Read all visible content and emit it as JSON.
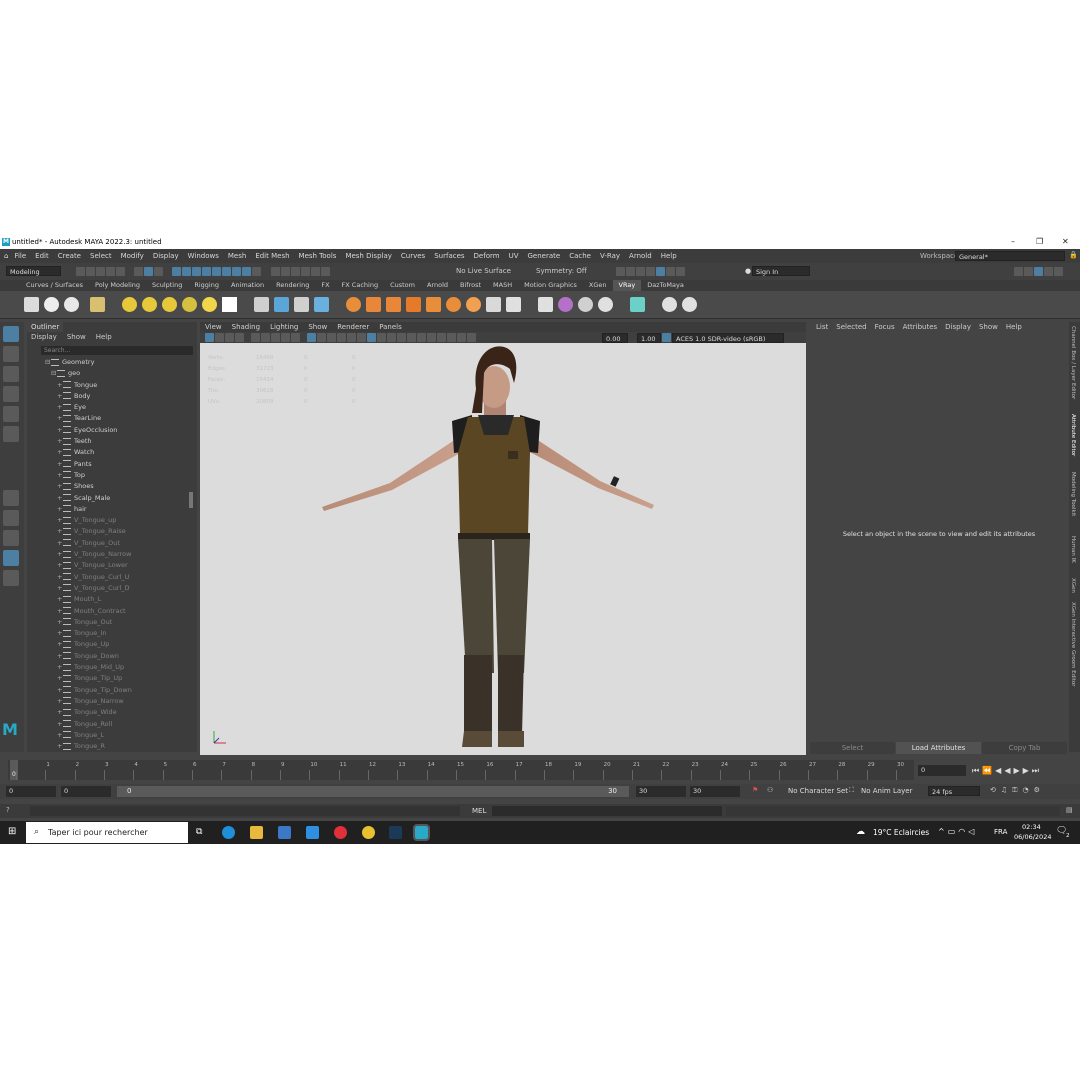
{
  "window": {
    "title": "untitled* - Autodesk MAYA 2022.3: untitled",
    "app_letter": "M"
  },
  "menu": [
    "File",
    "Edit",
    "Create",
    "Select",
    "Modify",
    "Display",
    "Windows",
    "Mesh",
    "Edit Mesh",
    "Mesh Tools",
    "Mesh Display",
    "Curves",
    "Surfaces",
    "Deform",
    "UV",
    "Generate",
    "Cache",
    "V-Ray",
    "Arnold",
    "Help"
  ],
  "workspace": {
    "label": "Workspace:",
    "value": "General*"
  },
  "toolbar": {
    "mode": "Modeling",
    "live_surface": "No Live Surface",
    "symmetry": "Symmetry: Off",
    "sign_in": "Sign In"
  },
  "shelf_tabs": [
    "Curves / Surfaces",
    "Poly Modeling",
    "Sculpting",
    "Rigging",
    "Animation",
    "Rendering",
    "FX",
    "FX Caching",
    "Custom",
    "Arnold",
    "Bifrost",
    "MASH",
    "Motion Graphics",
    "XGen",
    "VRay",
    "DazToMaya"
  ],
  "shelf_active": "VRay",
  "outliner": {
    "tab": "Outliner",
    "menu": [
      "Display",
      "Show",
      "Help"
    ],
    "search_placeholder": "Search...",
    "items": [
      {
        "label": "Geometry",
        "dim": false
      },
      {
        "label": "geo",
        "dim": false
      },
      {
        "label": "Tongue",
        "dim": false
      },
      {
        "label": "Body",
        "dim": false
      },
      {
        "label": "Eye",
        "dim": false
      },
      {
        "label": "TearLine",
        "dim": false
      },
      {
        "label": "EyeOcclusion",
        "dim": false
      },
      {
        "label": "Teeth",
        "dim": false
      },
      {
        "label": "Watch",
        "dim": false
      },
      {
        "label": "Pants",
        "dim": false
      },
      {
        "label": "Top",
        "dim": false
      },
      {
        "label": "Shoes",
        "dim": false
      },
      {
        "label": "Scalp_Male",
        "dim": false
      },
      {
        "label": "hair",
        "dim": false
      },
      {
        "label": "V_Tongue_up",
        "dim": true
      },
      {
        "label": "V_Tongue_Raise",
        "dim": true
      },
      {
        "label": "V_Tongue_Out",
        "dim": true
      },
      {
        "label": "V_Tongue_Narrow",
        "dim": true
      },
      {
        "label": "V_Tongue_Lower",
        "dim": true
      },
      {
        "label": "V_Tongue_Curl_U",
        "dim": true
      },
      {
        "label": "V_Tongue_Curl_D",
        "dim": true
      },
      {
        "label": "Mouth_L",
        "dim": true
      },
      {
        "label": "Mouth_Contract",
        "dim": true
      },
      {
        "label": "Tongue_Out",
        "dim": true
      },
      {
        "label": "Tongue_In",
        "dim": true
      },
      {
        "label": "Tongue_Up",
        "dim": true
      },
      {
        "label": "Tongue_Down",
        "dim": true
      },
      {
        "label": "Tongue_Mid_Up",
        "dim": true
      },
      {
        "label": "Tongue_Tip_Up",
        "dim": true
      },
      {
        "label": "Tongue_Tip_Down",
        "dim": true
      },
      {
        "label": "Tongue_Narrow",
        "dim": true
      },
      {
        "label": "Tongue_Wide",
        "dim": true
      },
      {
        "label": "Tongue_Roll",
        "dim": true
      },
      {
        "label": "Tongue_L",
        "dim": true
      },
      {
        "label": "Tongue_R",
        "dim": true
      }
    ]
  },
  "viewport": {
    "menu": [
      "View",
      "Shading",
      "Lighting",
      "Show",
      "Renderer",
      "Panels"
    ],
    "field_a": "0.00",
    "field_b": "1.00",
    "color_space": "ACES 1.0 SDR-video (sRGB)",
    "hud": [
      {
        "label": "Verts:",
        "a": "16468",
        "b": "0",
        "c": "0"
      },
      {
        "label": "Edges:",
        "a": "31723",
        "b": "0",
        "c": "0"
      },
      {
        "label": "Faces:",
        "a": "15414",
        "b": "0",
        "c": "0"
      },
      {
        "label": "Tris:",
        "a": "30628",
        "b": "0",
        "c": "0"
      },
      {
        "label": "UVs:",
        "a": "20809",
        "b": "0",
        "c": "0"
      }
    ]
  },
  "attribute_editor": {
    "menu": [
      "List",
      "Selected",
      "Focus",
      "Attributes",
      "Display",
      "Show",
      "Help"
    ],
    "message": "Select an object in the scene to view and edit its attributes",
    "buttons": [
      "Select",
      "Load Attributes",
      "Copy Tab"
    ]
  },
  "side_tabs": [
    "Channel Box / Layer Editor",
    "Attribute Editor",
    "Modeling Toolkit",
    "Human IK",
    "XGen",
    "XGen Interactive Groom Editor"
  ],
  "timeline": {
    "ticks": [
      "0",
      "1",
      "2",
      "3",
      "4",
      "5",
      "6",
      "7",
      "8",
      "9",
      "10",
      "11",
      "12",
      "13",
      "14",
      "15",
      "16",
      "17",
      "18",
      "19",
      "20",
      "21",
      "22",
      "23",
      "24",
      "25",
      "26",
      "27",
      "28",
      "29",
      "30"
    ],
    "current_frame": "0",
    "current_frame_field": "0"
  },
  "range": {
    "start": "0",
    "start2": "0",
    "slider_start": "0",
    "slider_end": "30",
    "end": "30",
    "end2": "30",
    "character_set": "No Character Set",
    "anim_layer": "No Anim Layer",
    "fps": "24 fps"
  },
  "command_line": {
    "lang": "MEL"
  },
  "taskbar": {
    "search_placeholder": "Taper ici pour rechercher",
    "weather": "19°C  Eclaircies",
    "lang": "FRA",
    "time": "02:34",
    "date": "06/06/2024",
    "notif": "2"
  },
  "colors": {
    "accent": "#4d7fa3",
    "panel": "#444444",
    "viewport_bg": "#dcdcdc"
  }
}
